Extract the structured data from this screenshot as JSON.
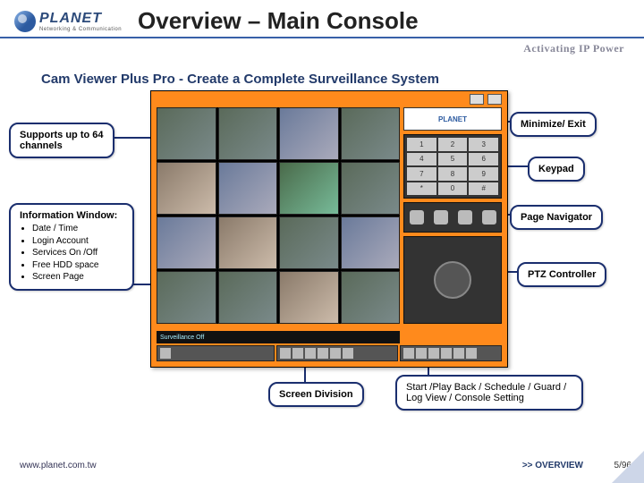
{
  "header": {
    "logo_text": "PLANET",
    "logo_sub": "Networking & Communication",
    "title": "Overview – Main Console",
    "tagline": "Activating IP Power"
  },
  "subtitle": "Cam Viewer Plus Pro - Create a Complete Surveillance System",
  "console": {
    "brand": "PLANET",
    "keypad": [
      "1",
      "2",
      "3",
      "4",
      "5",
      "6",
      "7",
      "8",
      "9",
      "*",
      "0",
      "#"
    ],
    "info_bar": "Surveillance Off"
  },
  "callouts": {
    "supports": "Supports up to 64 channels",
    "info_title": "Information Window:",
    "info_items": [
      "Date / Time",
      "Login Account",
      "Services On /Off",
      "Free HDD space",
      "Screen Page"
    ],
    "minimize": "Minimize/ Exit",
    "keypad": "Keypad",
    "page_nav": "Page Navigator",
    "ptz": "PTZ Controller",
    "screen_div": "Screen Division",
    "start": "Start /Play Back / Schedule / Guard / Log View / Console Setting"
  },
  "footer": {
    "url": "www.planet.com.tw",
    "nav": ">> OVERVIEW",
    "page": "5/96"
  }
}
